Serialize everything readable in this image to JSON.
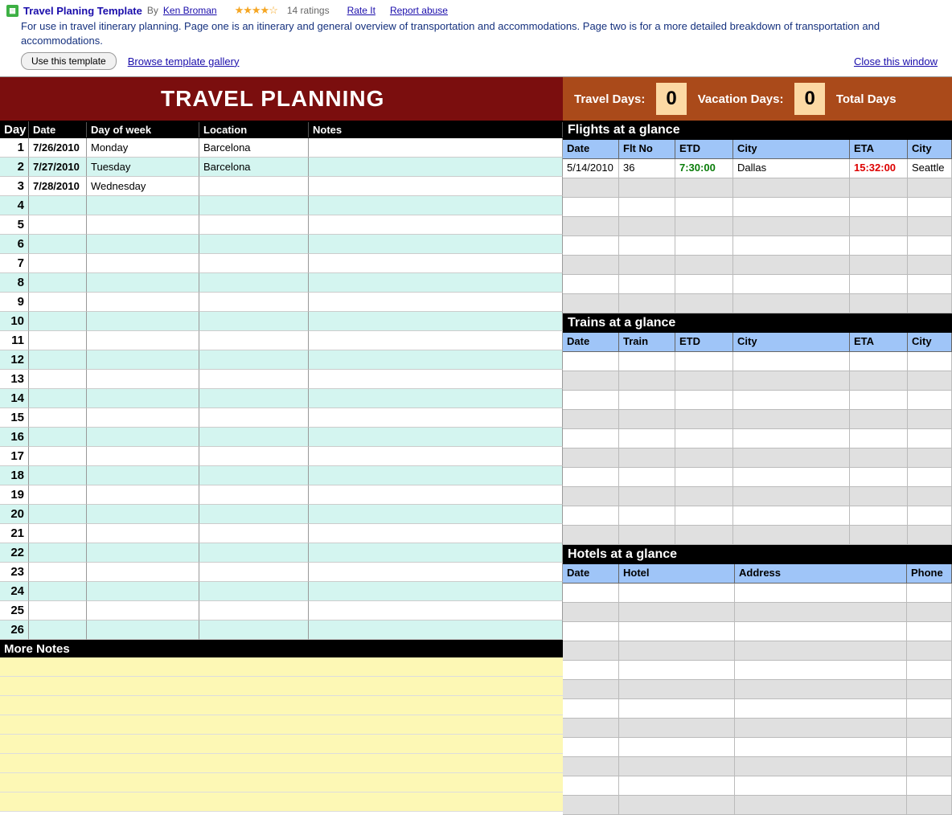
{
  "topbar": {
    "title": "Travel Planing Template",
    "by": "By",
    "author": "Ken Broman",
    "stars": "★★★★☆",
    "ratings": "14 ratings",
    "rate_it": "Rate It",
    "report": "Report abuse",
    "description": "For use in travel itinerary planning. Page one is an itinerary and general overview of transportation and accommodations. Page two is for a more detailed breakdown of transportation and accommodations.",
    "use_btn": "Use this template",
    "browse": "Browse template gallery",
    "close": "Close this window"
  },
  "banner": {
    "title": "TRAVEL PLANNING",
    "travel_days_label": "Travel Days:",
    "travel_days_val": "0",
    "vacation_days_label": "Vacation Days:",
    "vacation_days_val": "0",
    "total_days_label": "Total Days"
  },
  "itinerary": {
    "headers": {
      "day": "Day",
      "date": "Date",
      "dow": "Day of week",
      "loc": "Location",
      "notes": "Notes"
    },
    "rows": [
      {
        "day": "1",
        "date": "7/26/2010",
        "dow": "Monday",
        "loc": "Barcelona",
        "notes": ""
      },
      {
        "day": "2",
        "date": "7/27/2010",
        "dow": "Tuesday",
        "loc": "Barcelona",
        "notes": ""
      },
      {
        "day": "3",
        "date": "7/28/2010",
        "dow": "Wednesday",
        "loc": "",
        "notes": ""
      },
      {
        "day": "4",
        "date": "",
        "dow": "",
        "loc": "",
        "notes": ""
      },
      {
        "day": "5",
        "date": "",
        "dow": "",
        "loc": "",
        "notes": ""
      },
      {
        "day": "6",
        "date": "",
        "dow": "",
        "loc": "",
        "notes": ""
      },
      {
        "day": "7",
        "date": "",
        "dow": "",
        "loc": "",
        "notes": ""
      },
      {
        "day": "8",
        "date": "",
        "dow": "",
        "loc": "",
        "notes": ""
      },
      {
        "day": "9",
        "date": "",
        "dow": "",
        "loc": "",
        "notes": ""
      },
      {
        "day": "10",
        "date": "",
        "dow": "",
        "loc": "",
        "notes": ""
      },
      {
        "day": "11",
        "date": "",
        "dow": "",
        "loc": "",
        "notes": ""
      },
      {
        "day": "12",
        "date": "",
        "dow": "",
        "loc": "",
        "notes": ""
      },
      {
        "day": "13",
        "date": "",
        "dow": "",
        "loc": "",
        "notes": ""
      },
      {
        "day": "14",
        "date": "",
        "dow": "",
        "loc": "",
        "notes": ""
      },
      {
        "day": "15",
        "date": "",
        "dow": "",
        "loc": "",
        "notes": ""
      },
      {
        "day": "16",
        "date": "",
        "dow": "",
        "loc": "",
        "notes": ""
      },
      {
        "day": "17",
        "date": "",
        "dow": "",
        "loc": "",
        "notes": ""
      },
      {
        "day": "18",
        "date": "",
        "dow": "",
        "loc": "",
        "notes": ""
      },
      {
        "day": "19",
        "date": "",
        "dow": "",
        "loc": "",
        "notes": ""
      },
      {
        "day": "20",
        "date": "",
        "dow": "",
        "loc": "",
        "notes": ""
      },
      {
        "day": "21",
        "date": "",
        "dow": "",
        "loc": "",
        "notes": ""
      },
      {
        "day": "22",
        "date": "",
        "dow": "",
        "loc": "",
        "notes": ""
      },
      {
        "day": "23",
        "date": "",
        "dow": "",
        "loc": "",
        "notes": ""
      },
      {
        "day": "24",
        "date": "",
        "dow": "",
        "loc": "",
        "notes": ""
      },
      {
        "day": "25",
        "date": "",
        "dow": "",
        "loc": "",
        "notes": ""
      },
      {
        "day": "26",
        "date": "",
        "dow": "",
        "loc": "",
        "notes": ""
      }
    ]
  },
  "more_notes": {
    "title": "More Notes",
    "rows": 8
  },
  "flights": {
    "title": "Flights at a glance",
    "headers": {
      "date": "Date",
      "no": "Flt No",
      "etd": "ETD",
      "city": "City",
      "eta": "ETA",
      "city2": "City"
    },
    "rows": [
      {
        "date": "5/14/2010",
        "no": "36",
        "etd": "7:30:00",
        "city": "Dallas",
        "eta": "15:32:00",
        "city2": "Seattle"
      }
    ],
    "blank_rows": 7
  },
  "trains": {
    "title": "Trains at a glance",
    "headers": {
      "date": "Date",
      "train": "Train",
      "etd": "ETD",
      "city": "City",
      "eta": "ETA",
      "city2": "City"
    },
    "blank_rows": 10
  },
  "hotels": {
    "title": "Hotels at a glance",
    "headers": {
      "date": "Date",
      "hotel": "Hotel",
      "addr": "Address",
      "phone": "Phone"
    },
    "blank_rows": 12
  }
}
